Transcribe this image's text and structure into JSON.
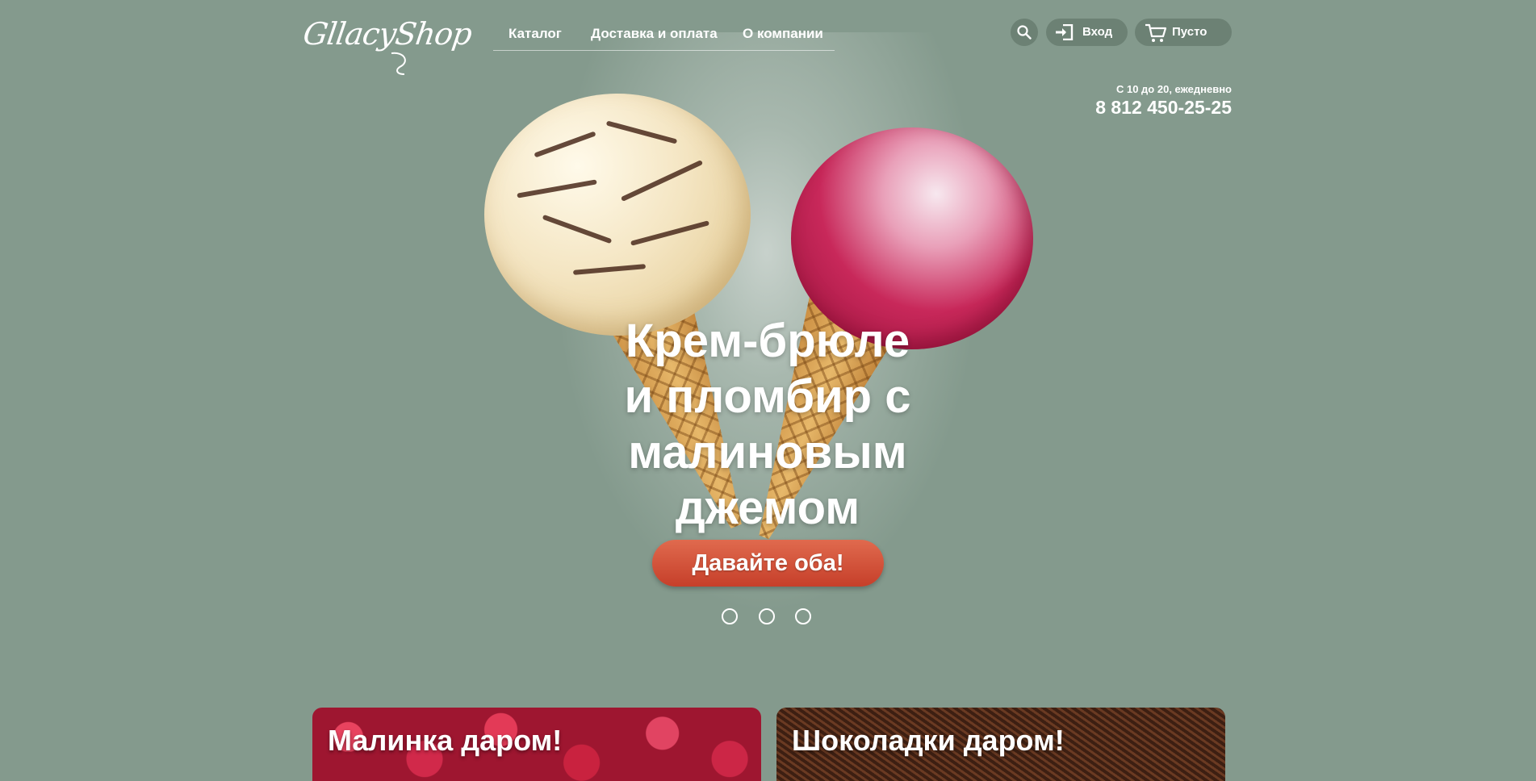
{
  "header": {
    "logo_text": "GllacyShop",
    "nav": [
      "Каталог",
      "Доставка и оплата",
      "О компании"
    ],
    "login_label": "Вход",
    "cart_label": "Пусто",
    "hours": "С 10 до 20, ежедневно",
    "phone": "8 812 450-25-25"
  },
  "hero": {
    "title_lines": [
      "Крем-брюле",
      "и пломбир с",
      "малиновым",
      "джемом"
    ],
    "cta_label": "Давайте оба!",
    "slides_count": 3
  },
  "promos": [
    {
      "title": "Малинка даром!"
    },
    {
      "title": "Шоколадки даром!"
    }
  ],
  "colors": {
    "background": "#849a8d",
    "cta": "#d2513a",
    "pill": "#6c8174"
  }
}
